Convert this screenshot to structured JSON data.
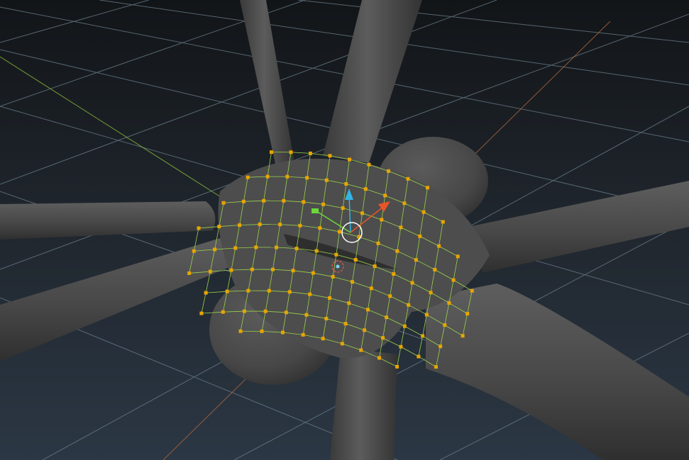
{
  "viewport": {
    "kind": "3d-modeling-viewport",
    "mode": "vertex-edit",
    "colors": {
      "background_top": "#121518",
      "background_bottom": "#2b3744",
      "grid_line": "#6b7f8c",
      "axis_x": "#b2683c",
      "axis_z": "#8fbf3a",
      "mesh_fill": "#4a4a4a",
      "mesh_highlight": "#5a5a5a",
      "selected_wire": "#9ad34a",
      "selected_vertex": "#e8a400",
      "gizmo_y_arrow": "#33b5e5",
      "gizmo_x_arrow": "#e8542a",
      "gizmo_z_handle": "#6cd63a",
      "gizmo_circle": "#ffffff",
      "pivot": "#d9534f"
    },
    "objects": [
      {
        "name": "spider-body-mesh",
        "icon": "mesh-object"
      },
      {
        "name": "vertex-selection",
        "icon": "selected-vertices"
      },
      {
        "name": "move-gizmo",
        "icon": "transform-move"
      }
    ]
  }
}
